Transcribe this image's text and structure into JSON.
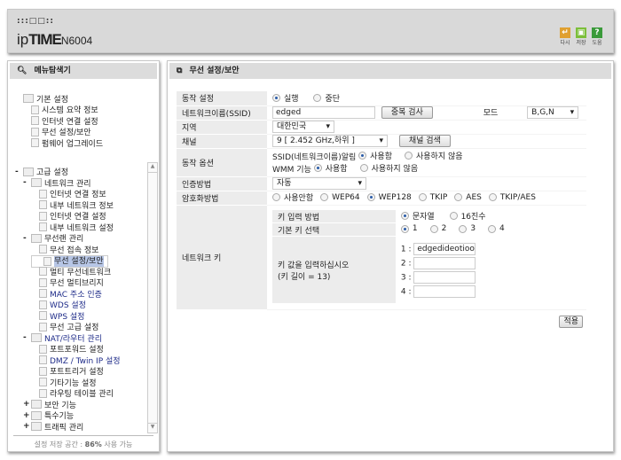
{
  "header": {
    "brand_dots": ":::□□::",
    "brand_prefix": "ip",
    "brand_bold": "TIME",
    "model": "N6004",
    "buttons": [
      {
        "label": "다시",
        "color": "#e0a030"
      },
      {
        "label": "저장",
        "color": "#7cbf3a"
      },
      {
        "label": "도움",
        "color": "#3a9a3a",
        "glyph": "?"
      }
    ]
  },
  "sidebar": {
    "title": "메뉴탐색기",
    "items": [
      {
        "label": "기본 설정",
        "level": 0,
        "pm": ""
      },
      {
        "label": "시스템 요약 정보",
        "level": 1
      },
      {
        "label": "인터넷 연결 설정",
        "level": 1
      },
      {
        "label": "무선 설정/보안",
        "level": 1
      },
      {
        "label": "펌웨어 업그레이드",
        "level": 1
      },
      {
        "label": "고급 설정",
        "level": 0,
        "pm": "-",
        "gap": true
      },
      {
        "label": "네트워크 관리",
        "level": 1,
        "pm": "-"
      },
      {
        "label": "인터넷 연결 정보",
        "level": 2
      },
      {
        "label": "내부 네트워크 정보",
        "level": 2
      },
      {
        "label": "인터넷 연결 설정",
        "level": 2
      },
      {
        "label": "내부 네트워크 설정",
        "level": 2
      },
      {
        "label": "무선랜 관리",
        "level": 1,
        "pm": "-"
      },
      {
        "label": "무선 접속 정보",
        "level": 2
      },
      {
        "label": "무선 설정/보안",
        "level": 2,
        "selected": true
      },
      {
        "label": "멀티 무선네트워크",
        "level": 2
      },
      {
        "label": "무선 멀티브리지",
        "level": 2
      },
      {
        "label": "MAC 주소 인증",
        "level": 2
      },
      {
        "label": "WDS 설정",
        "level": 2
      },
      {
        "label": "WPS 설정",
        "level": 2
      },
      {
        "label": "무선 고급 설정",
        "level": 2
      },
      {
        "label": "NAT/라우터 관리",
        "level": 1,
        "pm": "-"
      },
      {
        "label": "포트포워드 설정",
        "level": 2
      },
      {
        "label": "DMZ / Twin IP 설정",
        "level": 2
      },
      {
        "label": "포트트리거 설정",
        "level": 2
      },
      {
        "label": "기타기능 설정",
        "level": 2
      },
      {
        "label": "라우팅 테이블 관리",
        "level": 2
      },
      {
        "label": "보안 기능",
        "level": 1,
        "pm": "+"
      },
      {
        "label": "특수기능",
        "level": 1,
        "pm": "+"
      },
      {
        "label": "트래픽 관리",
        "level": 1,
        "pm": "+"
      }
    ],
    "footer_prefix": "설정 저장 공간 : ",
    "footer_value": "86%",
    "footer_suffix": " 사용 가능"
  },
  "main": {
    "title": "무선 설정/보안",
    "op": {
      "label": "동작 설정",
      "opt1": "실행",
      "opt2": "중단"
    },
    "ssid": {
      "label": "네트워크이름(SSID)",
      "value": "edged",
      "check_btn": "중복 검사",
      "mode_label": "모드",
      "mode_value": "B,G,N"
    },
    "region": {
      "label": "지역",
      "value": "대한민국"
    },
    "channel": {
      "label": "채널",
      "value": "9  [ 2.452 GHz,하위 ]",
      "search_btn": "채널 검색"
    },
    "options": {
      "label": "동작 옵션",
      "ssid_bc": "SSID(네트워크이름)알림",
      "wmm": "WMM 기능",
      "use": "사용함",
      "nouse": "사용하지 않음"
    },
    "auth": {
      "label": "인증방법",
      "value": "자동"
    },
    "enc": {
      "label": "암호화방법",
      "options": [
        "사용안함",
        "WEP64",
        "WEP128",
        "TKIP",
        "AES",
        "TKIP/AES"
      ],
      "selected": "WEP128"
    },
    "key": {
      "label": "네트워크 키",
      "input_method": "키 입력 방법",
      "m1": "문자열",
      "m2": "16진수",
      "default_key": "기본 키 선택",
      "keys": [
        "1",
        "2",
        "3",
        "4"
      ],
      "prompt": "키 값을 입력하십시오",
      "length": "(키 길이 = 13)",
      "values": [
        "edgedideotioo",
        "",
        "",
        ""
      ]
    },
    "apply": "적용"
  }
}
